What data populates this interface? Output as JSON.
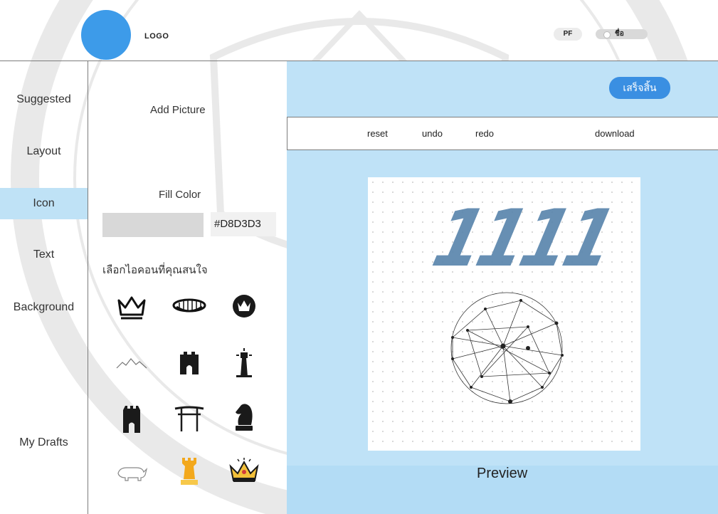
{
  "header": {
    "logo_label": "LOGO",
    "profile_initials": "PF",
    "user_name": "ชื่อ"
  },
  "sidebar": {
    "items": [
      {
        "label": "Suggested",
        "active": false
      },
      {
        "label": "Layout",
        "active": false
      },
      {
        "label": "Icon",
        "active": true
      },
      {
        "label": "Text",
        "active": false
      },
      {
        "label": "Background",
        "active": false
      }
    ],
    "drafts_label": "My Drafts"
  },
  "panel": {
    "add_picture_label": "Add Picture",
    "fill_color_label": "Fill Color",
    "fill_color_value": "#D8D3D3",
    "pick_icon_label": "เลือกไอคอนที่คุณสนใจ",
    "icons": [
      {
        "name": "crown-outline-icon"
      },
      {
        "name": "tiara-icon"
      },
      {
        "name": "crown-badge-icon"
      },
      {
        "name": "mountain-icon"
      },
      {
        "name": "castle-gate-icon"
      },
      {
        "name": "lighthouse-icon"
      },
      {
        "name": "tower-icon"
      },
      {
        "name": "torii-gate-icon"
      },
      {
        "name": "chess-knight-icon"
      },
      {
        "name": "rhino-icon"
      },
      {
        "name": "gold-rook-icon"
      },
      {
        "name": "gold-crown-icon"
      }
    ]
  },
  "editor": {
    "done_label": "เสร็จสิ้น",
    "toolbar": {
      "reset": "reset",
      "undo": "undo",
      "redo": "redo",
      "download": "download"
    },
    "canvas_text": "1111",
    "preview_label": "Preview"
  },
  "colors": {
    "accent": "#3a8fe2",
    "logo": "#3d9be9",
    "active_nav": "#bfe2f6",
    "editor_bg": "#bfe2f7",
    "canvas_text": "#5b86ad"
  }
}
